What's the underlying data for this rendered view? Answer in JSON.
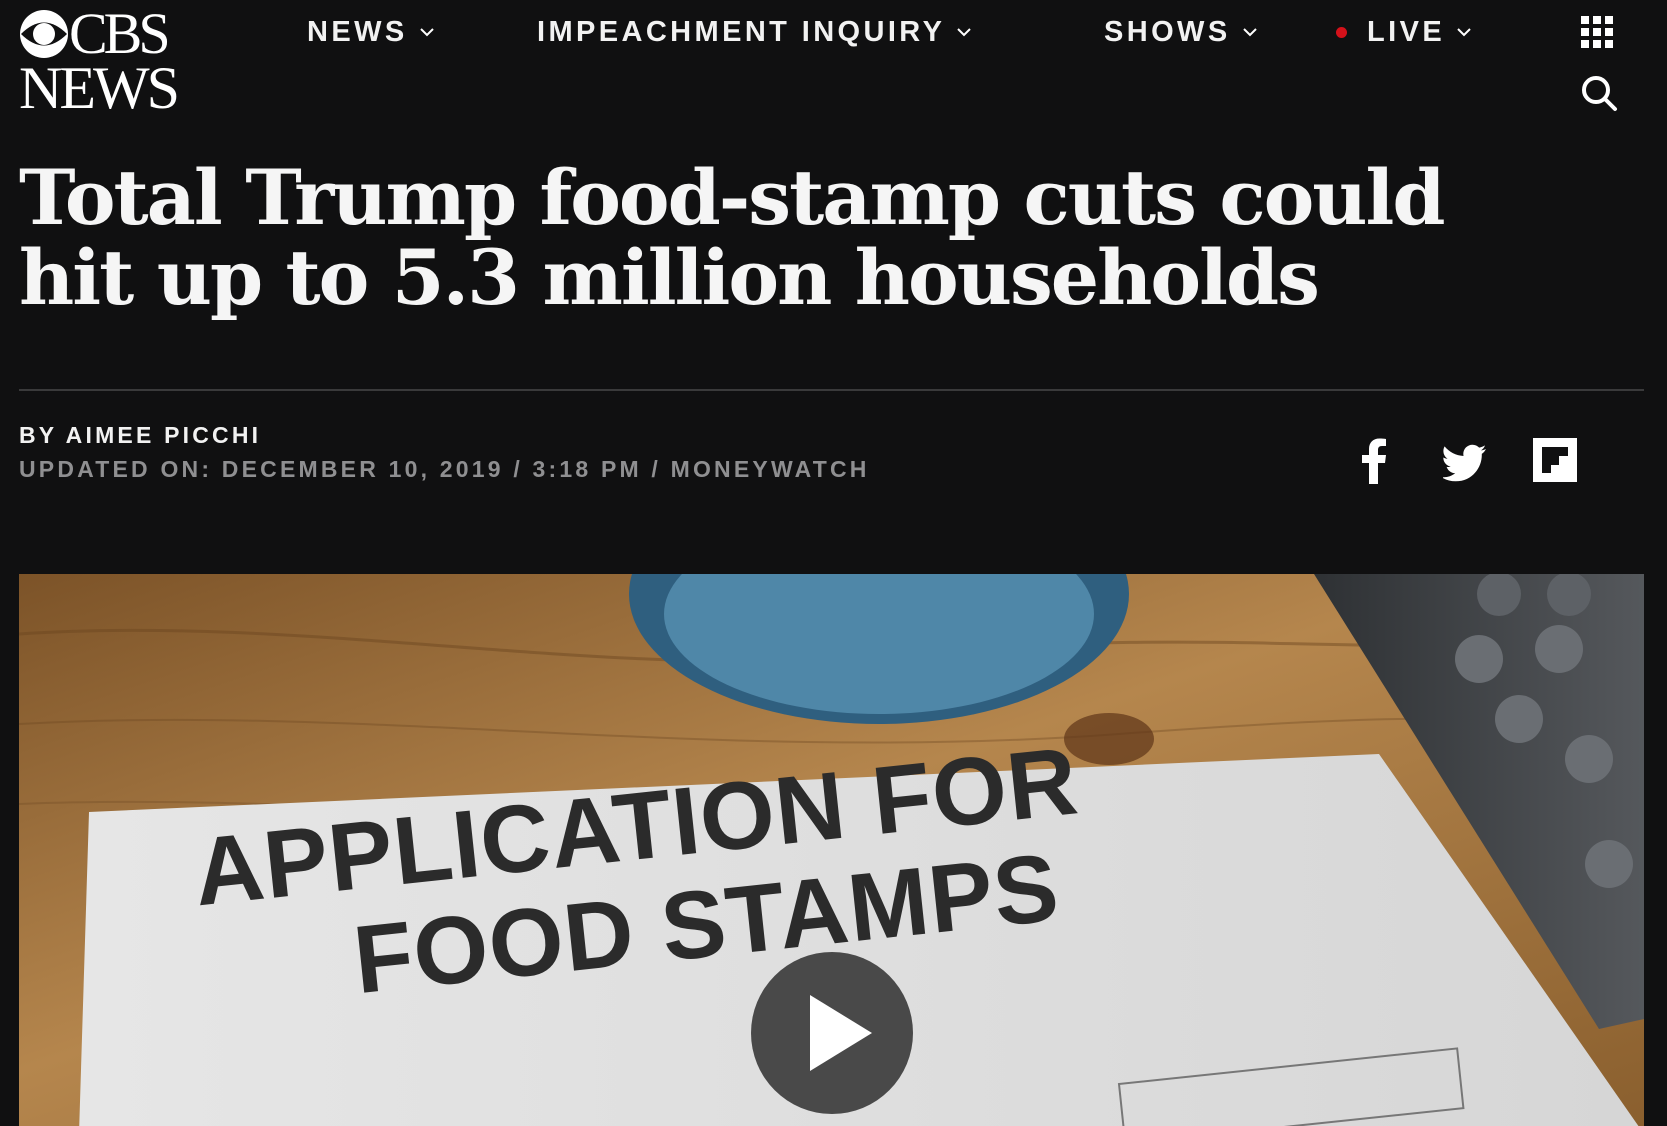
{
  "brand": {
    "line1": "CBS",
    "line2": "NEWS",
    "logo_icon": "cbs-eye-icon"
  },
  "nav": {
    "items": [
      {
        "label": "NEWS"
      },
      {
        "label": "IMPEACHMENT INQUIRY"
      },
      {
        "label": "SHOWS"
      },
      {
        "label": "LIVE"
      }
    ],
    "live_dot_color": "#d4111a",
    "apps_icon": "grid-apps-icon",
    "search_icon": "search-icon"
  },
  "article": {
    "headline": "Total Trump food-stamp cuts could hit up to 5.3 million households",
    "byline": "BY AIMEE PICCHI",
    "updated": "UPDATED ON: DECEMBER 10, 2019 / 3:18 PM / MONEYWATCH"
  },
  "share": {
    "icons": [
      "facebook-icon",
      "twitter-icon",
      "flipboard-icon"
    ]
  },
  "hero": {
    "document_line1": "APPLICATION FOR",
    "document_line2": "FOOD STAMPS",
    "play_icon": "play-icon"
  },
  "colors": {
    "background": "#101011",
    "text": "#f4f4f4",
    "muted": "#8f8f91"
  }
}
